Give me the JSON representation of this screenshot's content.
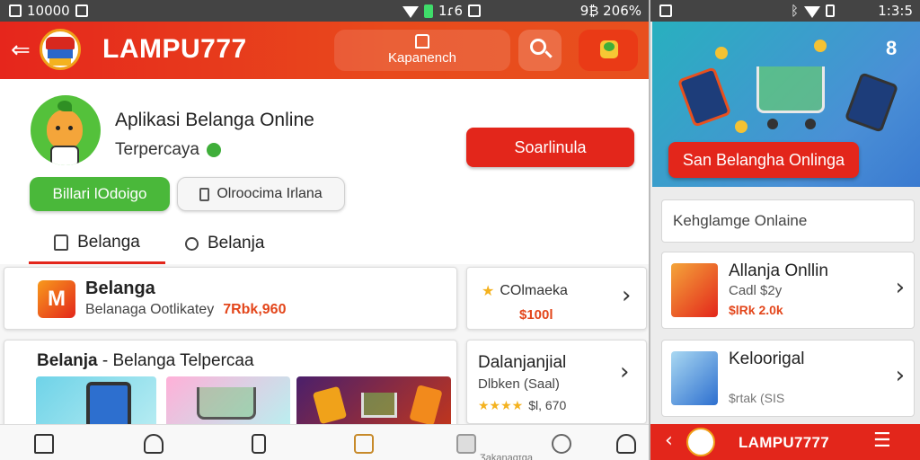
{
  "left": {
    "status": {
      "time": "10000",
      "indicator": "1ɾ6",
      "battery": "9₿ 206%"
    },
    "appbar": {
      "title": "LAMPU777",
      "home_label": "Kapanench"
    },
    "profile": {
      "title": "Aplikasi Belanga Online",
      "subtitle": "Terpercaya",
      "cta": "Soarlinula",
      "pill_primary": "Billari lOdoigo",
      "pill_secondary": "Olroocima Irlana"
    },
    "tabs": [
      {
        "label": "Belanga"
      },
      {
        "label": "Belanja"
      }
    ],
    "card1": {
      "logo": "M",
      "title": "Belanga",
      "subtitle": "Belanaga Ootlikatey",
      "price": "7Rbk,960"
    },
    "card2": {
      "title": "COlmaeka",
      "price": "$100l"
    },
    "card3": {
      "title_bold": "Belanja",
      "title_rest": " - Belanga  Telpercaa"
    },
    "card4": {
      "title": "Dalanjanjial",
      "subtitle": "Dlbken (Saal)",
      "rating": "★★★★",
      "price": "$l, 670"
    },
    "bottomnav_label": "Ʒakanaɑɪɡa"
  },
  "right": {
    "status": {
      "time": "1:3:5"
    },
    "hero_button": "San Belangha Onlinga",
    "search_placeholder": "Kehglamge Onlaine",
    "items": [
      {
        "title": "Allanja Onllin",
        "subtitle": "Cadl $2y",
        "price": "$lRk 2.0k"
      },
      {
        "title": "Keloorigal",
        "subtitle": "",
        "price": "$rtak (SIS"
      }
    ],
    "bottombar_title": "LAMPU7777"
  },
  "colors": {
    "accent": "#e3261b",
    "green": "#4ab83a",
    "hero": "#3a8fd0"
  }
}
